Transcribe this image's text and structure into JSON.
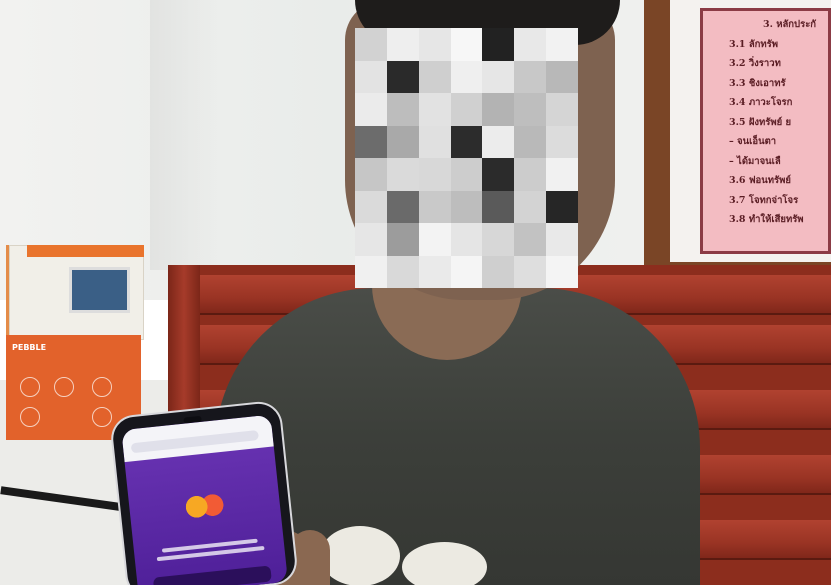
{
  "scene": {
    "poster": {
      "lines": [
        "3. หลักประกั",
        "3.1 ลักทรัพ",
        "3.2 วิ่งราวท",
        "3.3 ชิงเอาทรั",
        "3.4 ภาวะโจรก",
        "3.5 ฝังทรัพย์ ย",
        "– จนเอ็นตา",
        "– ได้มาจนเลื",
        "3.6 ฟอนทรัพย์",
        "3.7 โจทกจ่าโจร",
        "3.8 ทำให้เสียทรัพ"
      ]
    },
    "box": {
      "brand": "PEBBLE"
    },
    "colors": {
      "bench": "#9a3424",
      "poster": "#f3bcc2",
      "phone_app": "#5b29a6",
      "shirt": "#3c3f3a"
    }
  }
}
